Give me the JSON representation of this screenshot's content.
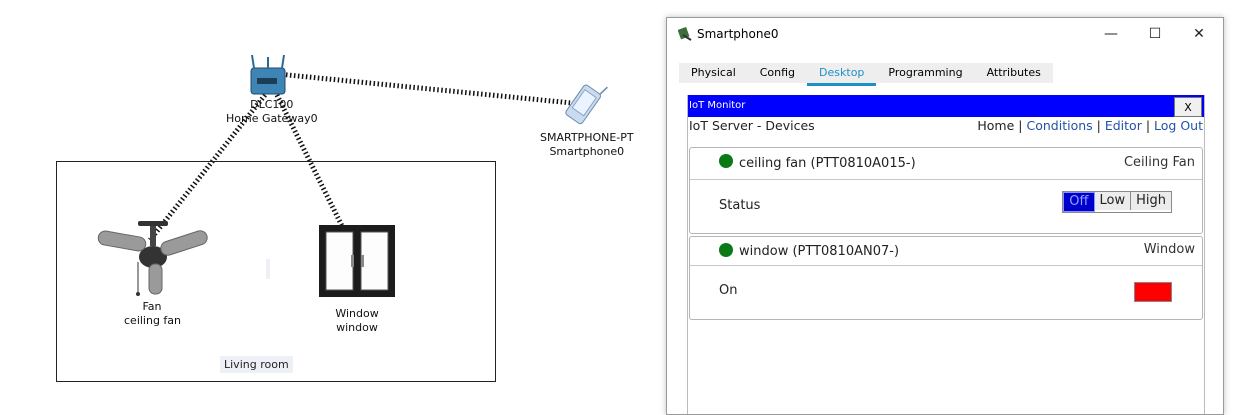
{
  "topology": {
    "gateway": {
      "model": "DLC100",
      "name": "Home Gateway0"
    },
    "smartphone": {
      "model": "SMARTPHONE-PT",
      "name": "Smartphone0"
    },
    "fan": {
      "type": "Fan",
      "name": "ceiling fan"
    },
    "window": {
      "type": "Window",
      "name": "window"
    },
    "room_label": "Living room"
  },
  "window": {
    "title": "Smartphone0",
    "minimize": "—",
    "maximize": "☐",
    "close": "✕",
    "tabs": [
      {
        "label": "Physical"
      },
      {
        "label": "Config"
      },
      {
        "label": "Desktop",
        "active": true
      },
      {
        "label": "Programming"
      },
      {
        "label": "Attributes"
      }
    ]
  },
  "iot": {
    "monitor_title": "IoT Monitor",
    "close_label": "X",
    "server_title": "IoT Server - Devices",
    "nav": {
      "home": "Home",
      "sep": "|",
      "conditions": "Conditions",
      "editor": "Editor",
      "logout": "Log Out"
    },
    "devices": [
      {
        "name": "ceiling fan (PTT0810A015-)",
        "type": "Ceiling Fan",
        "status_color": "#0a7a16",
        "control_label": "Status",
        "options": [
          "Off",
          "Low",
          "High"
        ],
        "selected": "Off"
      },
      {
        "name": "window (PTT0810AN07-)",
        "type": "Window",
        "status_color": "#0a7a16",
        "control_label": "On",
        "indicator_color": "#ff0000"
      }
    ]
  },
  "colors": {
    "accent": "#1e90c8",
    "iot_bar": "#0000ff",
    "link": "#2253a8"
  }
}
